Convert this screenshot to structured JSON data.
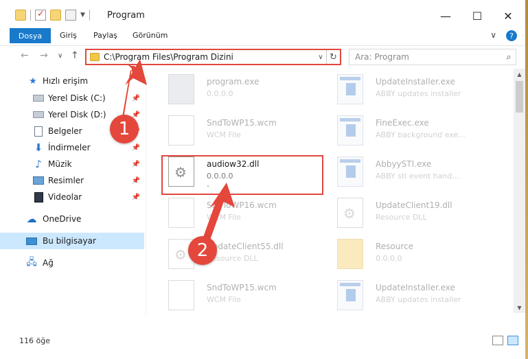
{
  "window": {
    "title": "Program",
    "controls": {
      "minimize": "—",
      "maximize": "☐",
      "close": "✕"
    }
  },
  "ribbon": {
    "tabs": [
      "Dosya",
      "Giriş",
      "Paylaş",
      "Görünüm"
    ],
    "expand": "∨",
    "help": "?"
  },
  "nav": {
    "back": "←",
    "forward": "→",
    "recent": "∨",
    "up": "↑",
    "address": "C:\\Program Files\\Program Dizini",
    "dropdown": "∨",
    "refresh": "↻",
    "search_placeholder": "Ara: Program",
    "search_icon": "⌕"
  },
  "sidebar": {
    "items": [
      {
        "label": "Hızlı erişim",
        "icon": "star-icon"
      },
      {
        "label": "Yerel Disk (C:)",
        "icon": "drive-icon",
        "pinned": true
      },
      {
        "label": "Yerel Disk (D:)",
        "icon": "drive-icon",
        "pinned": true
      },
      {
        "label": "Belgeler",
        "icon": "document-icon",
        "pinned": true
      },
      {
        "label": "İndirmeler",
        "icon": "download-icon",
        "pinned": true
      },
      {
        "label": "Müzik",
        "icon": "music-icon",
        "pinned": true
      },
      {
        "label": "Resimler",
        "icon": "pictures-icon",
        "pinned": true
      },
      {
        "label": "Videolar",
        "icon": "videos-icon",
        "pinned": true
      },
      {
        "label": "OneDrive",
        "icon": "cloud-icon"
      },
      {
        "label": "Bu bilgisayar",
        "icon": "computer-icon",
        "selected": true
      },
      {
        "label": "Ağ",
        "icon": "network-icon"
      }
    ]
  },
  "files": [
    {
      "name": "program.exe",
      "line1": "0.0.0.0",
      "line2": "",
      "icon": "program-icon",
      "faded": true
    },
    {
      "name": "UpdateInstaller.exe",
      "line1": "ABBY updates installer",
      "line2": "",
      "icon": "exe-icon",
      "faded": true
    },
    {
      "name": "SndToWP15.wcm",
      "line1": "WCM File",
      "line2": "",
      "icon": "blank-file-icon",
      "faded": true
    },
    {
      "name": "FineExec.exe",
      "line1": "ABBY background exe...",
      "line2": "",
      "icon": "exe-icon",
      "faded": true
    },
    {
      "name": "audiow32.dll",
      "line1": "0.0.0.0",
      "line2": "-",
      "icon": "dll-icon",
      "faded": false
    },
    {
      "name": "AbbyySTI.exe",
      "line1": "ABBY sti event hand...",
      "line2": "",
      "icon": "exe-icon",
      "faded": true
    },
    {
      "name": "SndToWP16.wcm",
      "line1": "WCM File",
      "line2": "",
      "icon": "blank-file-icon",
      "faded": true
    },
    {
      "name": "UpdateClient19.dll",
      "line1": "Resource DLL",
      "line2": "",
      "icon": "dll-icon",
      "faded": true
    },
    {
      "name": "UpdateClient55.dll",
      "line1": "Resource DLL",
      "line2": "",
      "icon": "dll-icon",
      "faded": true
    },
    {
      "name": "Resource",
      "line1": "0.0.0.0",
      "line2": "",
      "icon": "folder-icon",
      "faded": true
    },
    {
      "name": "SndToWP15.wcm",
      "line1": "WCM File",
      "line2": "",
      "icon": "blank-file-icon",
      "faded": true
    },
    {
      "name": "UpdateInstaller.exe",
      "line1": "ABBY updates installer",
      "line2": "",
      "icon": "exe-icon",
      "faded": true
    }
  ],
  "annotations": {
    "step1": "1",
    "step2": "2",
    "color": "#e4473b"
  },
  "status": {
    "item_count": "116 öğe"
  },
  "colors": {
    "accent": "#1979ca",
    "highlight_border": "#e0473f",
    "selected_bg": "#cce8ff"
  }
}
